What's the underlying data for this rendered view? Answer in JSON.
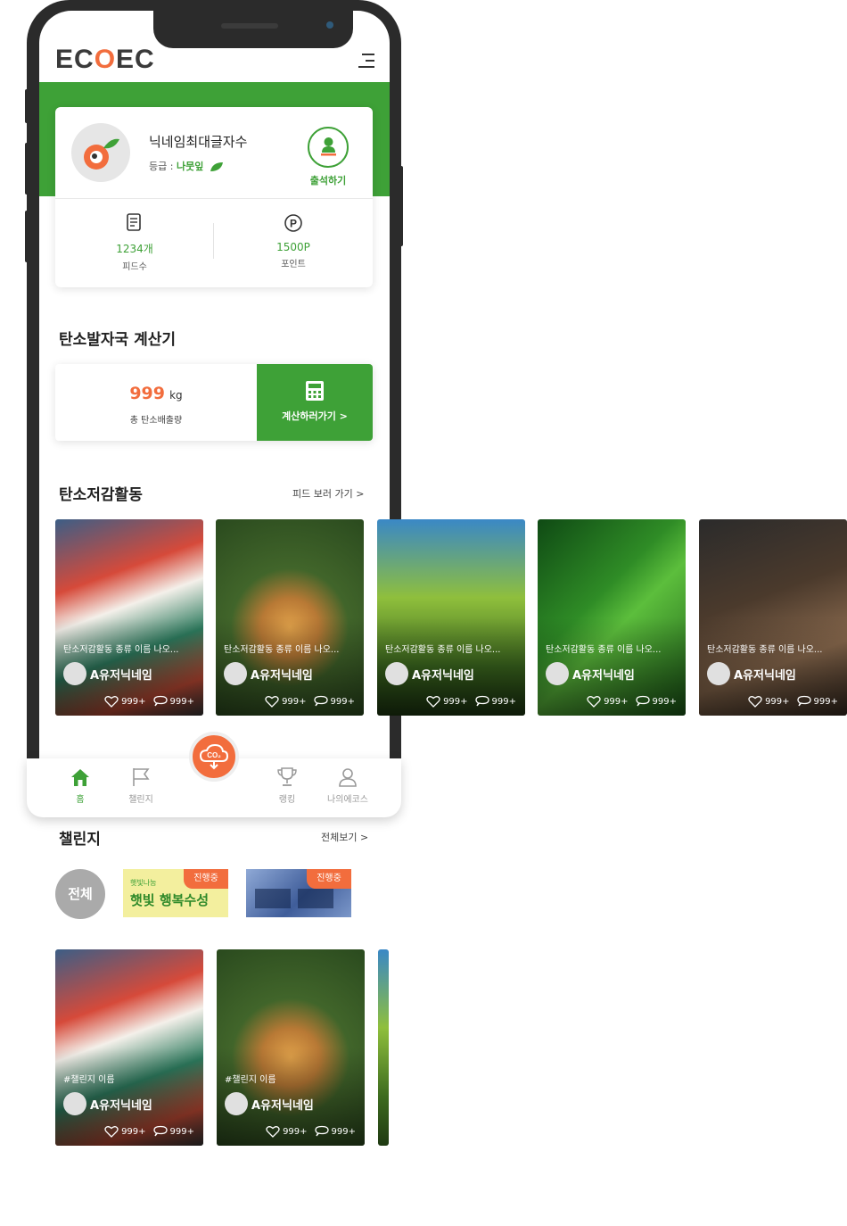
{
  "app": {
    "logo_text_a": "EC",
    "logo_text_o": "O",
    "logo_text_b": "EC"
  },
  "profile": {
    "nickname": "닉네임최대글자수",
    "grade_label": "등급 : ",
    "grade_value": "나뭇잎",
    "attend_label": "출석하기",
    "feeds_count": "1234개",
    "feeds_caption": "피드수",
    "points": "1500P",
    "points_caption": "포인트"
  },
  "calculator": {
    "title": "탄소발자국 계산기",
    "value": "999",
    "unit": "kg",
    "caption": "총 탄소배출량",
    "button_label": "계산하러가기 >"
  },
  "activities": {
    "title": "탄소저감활동",
    "more_label": "피드 보러 가기 >",
    "cards": [
      {
        "title": "탄소저감활동 종류 이름 나오...",
        "user": "A유저닉네임",
        "likes": "999+",
        "comments": "999+"
      },
      {
        "title": "탄소저감활동 종류 이름 나오...",
        "user": "A유저닉네임",
        "likes": "999+",
        "comments": "999+"
      },
      {
        "title": "탄소저감활동 종류 이름 나오...",
        "user": "A유저닉네임",
        "likes": "999+",
        "comments": "999+"
      },
      {
        "title": "탄소저감활동 종류 이름 나오...",
        "user": "A유저닉네임",
        "likes": "999+",
        "comments": "999+"
      },
      {
        "title": "탄소저감활동 종류 이름 나오...",
        "user": "A유저닉네임",
        "likes": "999+",
        "comments": "999+"
      }
    ]
  },
  "nav": {
    "co2_label": "CO₂",
    "items": [
      {
        "label": "홈",
        "icon": "home-icon",
        "active": true
      },
      {
        "label": "챌린지",
        "icon": "flag-icon",
        "active": false
      },
      {
        "label": "랭킹",
        "icon": "trophy-icon",
        "active": false
      },
      {
        "label": "나의에코스",
        "icon": "user-icon",
        "active": false
      }
    ]
  },
  "challenge": {
    "title": "챌린지",
    "more_label": "전체보기 >",
    "all_chip": "전체",
    "banner1_text": "햇빛 행복수성",
    "banner1_small": "햇빛나눔",
    "badge": "진행중",
    "cards": [
      {
        "tag": "#챌린지 이름",
        "user": "A유저닉네임",
        "likes": "999+",
        "comments": "999+"
      },
      {
        "tag": "#챌린지 이름",
        "user": "A유저닉네임",
        "likes": "999+",
        "comments": "999+"
      }
    ]
  },
  "colors": {
    "brand_green": "#3ea137",
    "accent_orange": "#f26d3d"
  }
}
